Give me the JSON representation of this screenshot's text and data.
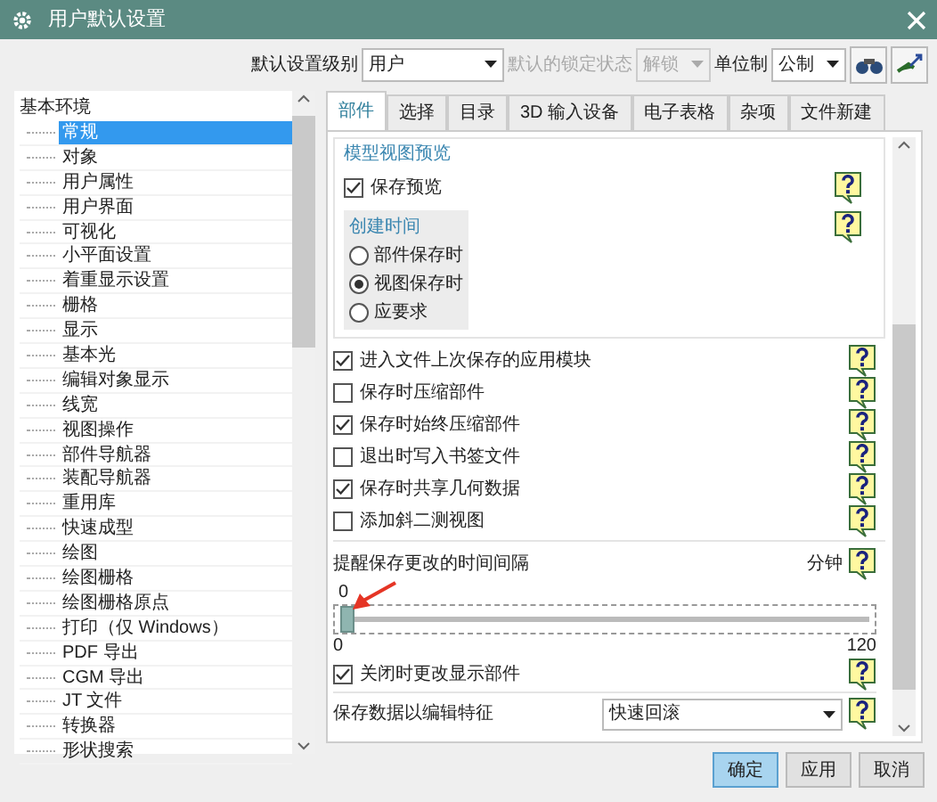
{
  "window": {
    "title": "用户默认设置"
  },
  "toolbar": {
    "level_label": "默认设置级别",
    "level_value": "用户",
    "lock_label": "默认的锁定状态",
    "lock_value": "解锁",
    "lock_disabled": true,
    "unit_label": "单位制",
    "unit_value": "公制"
  },
  "tree": {
    "root": "基本环境",
    "children": [
      {
        "label": "常规",
        "selected": true
      },
      {
        "label": "对象",
        "selected": false
      },
      {
        "label": "用户属性",
        "selected": false
      },
      {
        "label": "用户界面",
        "selected": false
      },
      {
        "label": "可视化",
        "selected": false
      },
      {
        "label": "小平面设置",
        "selected": false
      },
      {
        "label": "着重显示设置",
        "selected": false
      },
      {
        "label": "栅格",
        "selected": false
      },
      {
        "label": "显示",
        "selected": false
      },
      {
        "label": "基本光",
        "selected": false
      },
      {
        "label": "编辑对象显示",
        "selected": false
      },
      {
        "label": "线宽",
        "selected": false
      },
      {
        "label": "视图操作",
        "selected": false
      },
      {
        "label": "部件导航器",
        "selected": false
      },
      {
        "label": "装配导航器",
        "selected": false
      },
      {
        "label": "重用库",
        "selected": false
      },
      {
        "label": "快速成型",
        "selected": false
      },
      {
        "label": "绘图",
        "selected": false
      },
      {
        "label": "绘图栅格",
        "selected": false
      },
      {
        "label": "绘图栅格原点",
        "selected": false
      },
      {
        "label": "打印（仅 Windows）",
        "selected": false
      },
      {
        "label": "PDF 导出",
        "selected": false
      },
      {
        "label": "CGM 导出",
        "selected": false
      },
      {
        "label": "JT 文件",
        "selected": false
      },
      {
        "label": "转换器",
        "selected": false
      },
      {
        "label": "形状搜索",
        "selected": false
      }
    ]
  },
  "tabs": [
    {
      "label": "部件",
      "selected": true
    },
    {
      "label": "选择",
      "selected": false
    },
    {
      "label": "目录",
      "selected": false
    },
    {
      "label": "3D 输入设备",
      "selected": false
    },
    {
      "label": "电子表格",
      "selected": false
    },
    {
      "label": "杂项",
      "selected": false
    },
    {
      "label": "文件新建",
      "selected": false
    }
  ],
  "preview_group": {
    "title": "模型视图预览",
    "save_preview": {
      "label": "保存预览",
      "checked": true
    },
    "creation_time": {
      "title": "创建时间",
      "options": [
        {
          "label": "部件保存时",
          "selected": false
        },
        {
          "label": "视图保存时",
          "selected": true
        },
        {
          "label": "应要求",
          "selected": false
        }
      ]
    }
  },
  "options": [
    {
      "label": "进入文件上次保存的应用模块",
      "checked": true
    },
    {
      "label": "保存时压缩部件",
      "checked": false
    },
    {
      "label": "保存时始终压缩部件",
      "checked": true
    },
    {
      "label": "退出时写入书签文件",
      "checked": false
    },
    {
      "label": "保存时共享几何数据",
      "checked": true
    },
    {
      "label": "添加斜二测视图",
      "checked": false
    }
  ],
  "reminder": {
    "label": "提醒保存更改的时间间隔",
    "unit": "分钟",
    "value": "0",
    "level": 0,
    "min": "0",
    "max": "120"
  },
  "close_option": {
    "label": "关闭时更改显示部件",
    "checked": true
  },
  "edit_feature": {
    "label": "保存数据以编辑特征",
    "value": "快速回滚"
  },
  "buttons": [
    {
      "label": "确定",
      "selected": true
    },
    {
      "label": "应用",
      "selected": false
    },
    {
      "label": "取消",
      "selected": false
    }
  ]
}
